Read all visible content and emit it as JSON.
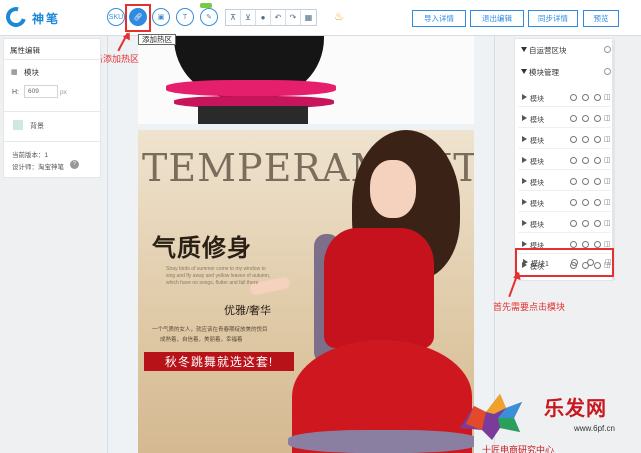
{
  "app": {
    "brand": "神笔"
  },
  "toolbar": {
    "sku_label": "SKU",
    "buttons": [
      "导入详情",
      "退出编辑",
      "同步详情",
      "预览"
    ]
  },
  "tooltip": {
    "text": "添加热区"
  },
  "annotations": {
    "click_hotspot": "在点击添加热区",
    "click_module": "首先需要点击模块"
  },
  "left_panel": {
    "title": "属性编辑",
    "module_label": "模块",
    "height_label": "H:",
    "height_value": "609",
    "height_unit": "px",
    "bg_label": "背景",
    "version": "当前版本：1",
    "designer": "设计师：淘宝神笔"
  },
  "right_panel": {
    "custom_section": "自运营区块",
    "module_section": "模块管理",
    "rows": [
      "模块",
      "模块",
      "模块",
      "模块",
      "模块",
      "模块",
      "模块",
      "模块",
      "模块"
    ],
    "selected_row": "模块1"
  },
  "canvas": {
    "big_word": "TEMPERAMENT",
    "headline": "气质修身",
    "sub_en": "Stray birds of summer come to my window to sing and fly away and yellow leaves of autumn, which have no songs, flutter and fall there",
    "elegant": "优雅/奢华",
    "tagline": "一个气质的女人，就应该在青春期绽放美的悦目",
    "tagline2": "成熟着，自信着，美丽着，幸福着",
    "banner": "秋冬跳舞就选这套!"
  },
  "watermark": {
    "brand": "乐发网",
    "url": "www.6pf.cn",
    "center": "十匠电商研究中心"
  },
  "colors": {
    "accent": "#2f8be0",
    "annotation": "#e53030",
    "banner": "#b81219"
  }
}
